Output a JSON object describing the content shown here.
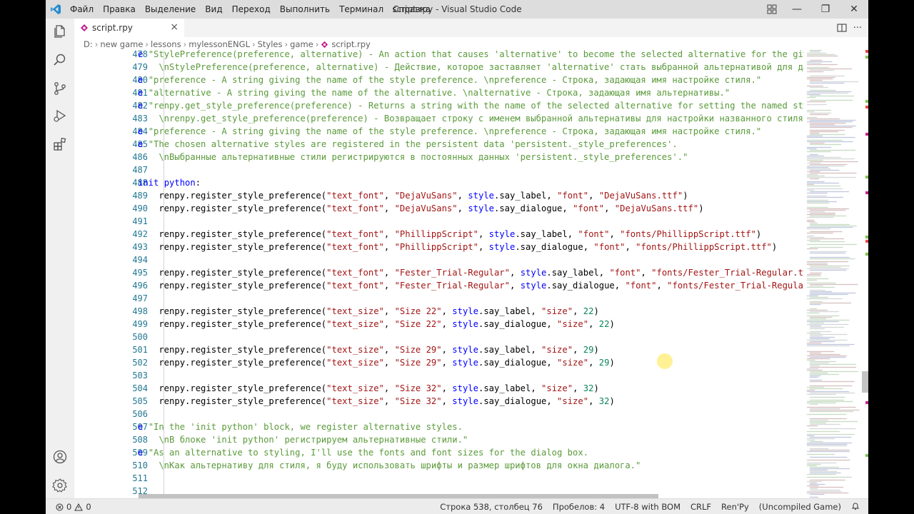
{
  "app": {
    "title": "script.rpy - Visual Studio Code",
    "logo_icon": "vscode-logo-icon"
  },
  "menu": [
    "Файл",
    "Правка",
    "Выделение",
    "Вид",
    "Переход",
    "Выполнить",
    "Терминал",
    "Справка"
  ],
  "window_controls": {
    "minimize": "—",
    "maximize": "❐",
    "close": "✕"
  },
  "tab": {
    "label": "script.rpy",
    "close": "×"
  },
  "breadcrumbs": [
    "D:",
    "new game",
    "lessons",
    "mylessonENGL",
    "Styles",
    "game",
    "script.rpy"
  ],
  "editor": {
    "lines": [
      {
        "n": "478",
        "code": [
          [
            "cmt-e",
            "e "
          ],
          [
            "strg",
            "\"StylePreference(preference, alternative) - An action that causes 'alternative' to become the selected alternative for the give"
          ]
        ]
      },
      {
        "n": "479",
        "code": [
          [
            "strg",
            "    \\nStylePreference(preference, alternative) - Действие, которое заставляет 'alternative' стать выбранной альтернативой для дан"
          ]
        ]
      },
      {
        "n": "480",
        "code": [
          [
            "cmt-e",
            "e "
          ],
          [
            "strg",
            "\"preference - A string giving the name of the style preference. \\npreference - Строка, задающая имя настройке стиля.\""
          ]
        ]
      },
      {
        "n": "481",
        "code": [
          [
            "cmt-e",
            "e "
          ],
          [
            "strg",
            "\"alternative - A string giving the name of the alternative. \\nalternative - Строка, задающая имя альтернативы.\""
          ]
        ]
      },
      {
        "n": "482",
        "code": [
          [
            "cmt-e",
            "e "
          ],
          [
            "strg",
            "\"renpy.get_style_preference(preference) - Returns a string with the name of the selected alternative for setting the named sty"
          ]
        ]
      },
      {
        "n": "483",
        "code": [
          [
            "strg",
            "    \\nrenpy.get_style_preference(preference) - Возвращает строку с именем выбранной альтернативы для настройки названного стиля."
          ]
        ]
      },
      {
        "n": "484",
        "code": [
          [
            "cmt-e",
            "e "
          ],
          [
            "strg",
            "\"preference - A string giving the name of the style preference. \\npreference - Строка, задающая имя настройке стиля.\""
          ]
        ]
      },
      {
        "n": "485",
        "code": [
          [
            "cmt-e",
            "e "
          ],
          [
            "strg",
            "\"The chosen alternative styles are registered in the persistent data 'persistent._style_preferences'."
          ]
        ]
      },
      {
        "n": "486",
        "code": [
          [
            "strg",
            "    \\nВыбранные альтернативные стили регистрируются в постоянных данных 'persistent._style_preferences'.\""
          ]
        ]
      },
      {
        "n": "487",
        "code": []
      },
      {
        "n": "488",
        "code": [
          [
            "kw",
            "init "
          ],
          [
            "kw",
            "python"
          ],
          [
            "fn",
            ":"
          ]
        ]
      },
      {
        "n": "489",
        "code": [
          [
            "fn",
            "    renpy.register_style_preference("
          ],
          [
            "str",
            "\"text_font\""
          ],
          [
            "fn",
            ", "
          ],
          [
            "str",
            "\"DejaVuSans\""
          ],
          [
            "fn",
            ", "
          ],
          [
            "kw",
            "style"
          ],
          [
            "fn",
            ".say_label, "
          ],
          [
            "str",
            "\"font\""
          ],
          [
            "fn",
            ", "
          ],
          [
            "str",
            "\"DejaVuSans.ttf\""
          ],
          [
            "fn",
            ")"
          ]
        ]
      },
      {
        "n": "490",
        "code": [
          [
            "fn",
            "    renpy.register_style_preference("
          ],
          [
            "str",
            "\"text_font\""
          ],
          [
            "fn",
            ", "
          ],
          [
            "str",
            "\"DejaVuSans\""
          ],
          [
            "fn",
            ", "
          ],
          [
            "kw",
            "style"
          ],
          [
            "fn",
            ".say_dialogue, "
          ],
          [
            "str",
            "\"font\""
          ],
          [
            "fn",
            ", "
          ],
          [
            "str",
            "\"DejaVuSans.ttf\""
          ],
          [
            "fn",
            ")"
          ]
        ]
      },
      {
        "n": "491",
        "code": []
      },
      {
        "n": "492",
        "code": [
          [
            "fn",
            "    renpy.register_style_preference("
          ],
          [
            "str",
            "\"text_font\""
          ],
          [
            "fn",
            ", "
          ],
          [
            "str",
            "\"PhillippScript\""
          ],
          [
            "fn",
            ", "
          ],
          [
            "kw",
            "style"
          ],
          [
            "fn",
            ".say_label, "
          ],
          [
            "str",
            "\"font\""
          ],
          [
            "fn",
            ", "
          ],
          [
            "str",
            "\"fonts/PhillippScript.ttf\""
          ],
          [
            "fn",
            ")"
          ]
        ]
      },
      {
        "n": "493",
        "code": [
          [
            "fn",
            "    renpy.register_style_preference("
          ],
          [
            "str",
            "\"text_font\""
          ],
          [
            "fn",
            ", "
          ],
          [
            "str",
            "\"PhillippScript\""
          ],
          [
            "fn",
            ", "
          ],
          [
            "kw",
            "style"
          ],
          [
            "fn",
            ".say_dialogue, "
          ],
          [
            "str",
            "\"font\""
          ],
          [
            "fn",
            ", "
          ],
          [
            "str",
            "\"fonts/PhillippScript.ttf\""
          ],
          [
            "fn",
            ")"
          ]
        ]
      },
      {
        "n": "494",
        "code": []
      },
      {
        "n": "495",
        "code": [
          [
            "fn",
            "    renpy.register_style_preference("
          ],
          [
            "str",
            "\"text_font\""
          ],
          [
            "fn",
            ", "
          ],
          [
            "str",
            "\"Fester_Trial-Regular\""
          ],
          [
            "fn",
            ", "
          ],
          [
            "kw",
            "style"
          ],
          [
            "fn",
            ".say_label, "
          ],
          [
            "str",
            "\"font\""
          ],
          [
            "fn",
            ", "
          ],
          [
            "str",
            "\"fonts/Fester_Trial-Regular.tt"
          ]
        ]
      },
      {
        "n": "496",
        "code": [
          [
            "fn",
            "    renpy.register_style_preference("
          ],
          [
            "str",
            "\"text_font\""
          ],
          [
            "fn",
            ", "
          ],
          [
            "str",
            "\"Fester_Trial-Regular\""
          ],
          [
            "fn",
            ", "
          ],
          [
            "kw",
            "style"
          ],
          [
            "fn",
            ".say_dialogue, "
          ],
          [
            "str",
            "\"font\""
          ],
          [
            "fn",
            ", "
          ],
          [
            "str",
            "\"fonts/Fester_Trial-Regular"
          ]
        ]
      },
      {
        "n": "497",
        "code": []
      },
      {
        "n": "498",
        "code": [
          [
            "fn",
            "    renpy.register_style_preference("
          ],
          [
            "str",
            "\"text_size\""
          ],
          [
            "fn",
            ", "
          ],
          [
            "str",
            "\"Size 22\""
          ],
          [
            "fn",
            ", "
          ],
          [
            "kw",
            "style"
          ],
          [
            "fn",
            ".say_label, "
          ],
          [
            "str",
            "\"size\""
          ],
          [
            "fn",
            ", "
          ],
          [
            "num",
            "22"
          ],
          [
            "fn",
            ")"
          ]
        ]
      },
      {
        "n": "499",
        "code": [
          [
            "fn",
            "    renpy.register_style_preference("
          ],
          [
            "str",
            "\"text_size\""
          ],
          [
            "fn",
            ", "
          ],
          [
            "str",
            "\"Size 22\""
          ],
          [
            "fn",
            ", "
          ],
          [
            "kw",
            "style"
          ],
          [
            "fn",
            ".say_dialogue, "
          ],
          [
            "str",
            "\"size\""
          ],
          [
            "fn",
            ", "
          ],
          [
            "num",
            "22"
          ],
          [
            "fn",
            ")"
          ]
        ]
      },
      {
        "n": "500",
        "code": []
      },
      {
        "n": "501",
        "code": [
          [
            "fn",
            "    renpy.register_style_preference("
          ],
          [
            "str",
            "\"text_size\""
          ],
          [
            "fn",
            ", "
          ],
          [
            "str",
            "\"Size 29\""
          ],
          [
            "fn",
            ", "
          ],
          [
            "kw",
            "style"
          ],
          [
            "fn",
            ".say_label, "
          ],
          [
            "str",
            "\"size\""
          ],
          [
            "fn",
            ", "
          ],
          [
            "num",
            "29"
          ],
          [
            "fn",
            ")"
          ]
        ]
      },
      {
        "n": "502",
        "code": [
          [
            "fn",
            "    renpy.register_style_preference("
          ],
          [
            "str",
            "\"text_size\""
          ],
          [
            "fn",
            ", "
          ],
          [
            "str",
            "\"Size 29\""
          ],
          [
            "fn",
            ", "
          ],
          [
            "kw",
            "style"
          ],
          [
            "fn",
            ".say_dialogue, "
          ],
          [
            "str",
            "\"size\""
          ],
          [
            "fn",
            ", "
          ],
          [
            "num",
            "29"
          ],
          [
            "fn",
            ")"
          ]
        ]
      },
      {
        "n": "503",
        "code": []
      },
      {
        "n": "504",
        "code": [
          [
            "fn",
            "    renpy.register_style_preference("
          ],
          [
            "str",
            "\"text_size\""
          ],
          [
            "fn",
            ", "
          ],
          [
            "str",
            "\"Size 32\""
          ],
          [
            "fn",
            ", "
          ],
          [
            "kw",
            "style"
          ],
          [
            "fn",
            ".say_label, "
          ],
          [
            "str",
            "\"size\""
          ],
          [
            "fn",
            ", "
          ],
          [
            "num",
            "32"
          ],
          [
            "fn",
            ")"
          ]
        ]
      },
      {
        "n": "505",
        "code": [
          [
            "fn",
            "    renpy.register_style_preference("
          ],
          [
            "str",
            "\"text_size\""
          ],
          [
            "fn",
            ", "
          ],
          [
            "str",
            "\"Size 32\""
          ],
          [
            "fn",
            ", "
          ],
          [
            "kw",
            "style"
          ],
          [
            "fn",
            ".say_dialogue, "
          ],
          [
            "str",
            "\"size\""
          ],
          [
            "fn",
            ", "
          ],
          [
            "num",
            "32"
          ],
          [
            "fn",
            ")"
          ]
        ]
      },
      {
        "n": "506",
        "code": []
      },
      {
        "n": "507",
        "code": [
          [
            "cmt-e",
            "e "
          ],
          [
            "strg",
            "\"In the 'init python' block, we register alternative styles."
          ]
        ]
      },
      {
        "n": "508",
        "code": [
          [
            "strg",
            "    \\nВ блоке 'init python' регистрируем альтернативные стили.\""
          ]
        ]
      },
      {
        "n": "509",
        "code": [
          [
            "cmt-e",
            "e "
          ],
          [
            "strg",
            "\"As an alternative to styling, I'll use the fonts and font sizes for the dialog box."
          ]
        ]
      },
      {
        "n": "510",
        "code": [
          [
            "strg",
            "    \\nКак альтернативу для стиля, я буду использовать шрифты и размер шрифтов для окна диалога.\""
          ]
        ]
      },
      {
        "n": "511",
        "code": []
      },
      {
        "n": "512",
        "code": []
      }
    ]
  },
  "status": {
    "errors": "0",
    "warnings": "0",
    "position": "Строка 538, столбец 76",
    "spaces": "Пробелов: 4",
    "encoding": "UTF-8 with BOM",
    "eol": "CRLF",
    "language": "Ren'Py",
    "game_status": "(Uncompiled Game)"
  },
  "colors": {
    "accent": "#0066b8",
    "keyword": "#0000ff",
    "string": "#a31515",
    "number": "#098658",
    "line_number": "#237893"
  }
}
